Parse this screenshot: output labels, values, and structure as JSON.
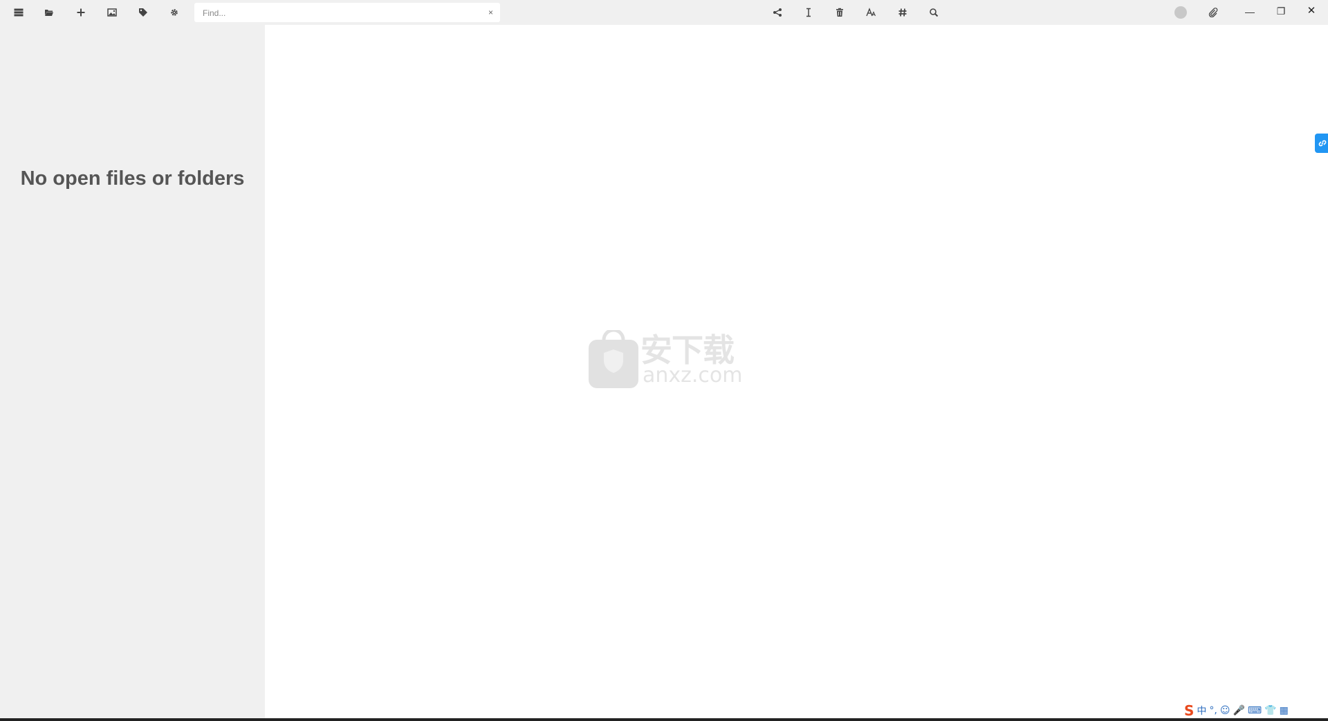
{
  "toolbar": {
    "left_icons": [
      "menu-icon",
      "folder-open-icon",
      "plus-icon",
      "image-icon",
      "tag-icon",
      "gear-icon"
    ],
    "find": {
      "placeholder": "Find...",
      "clear_glyph": "×"
    },
    "right_icons": [
      "share-icon",
      "text-cursor-icon",
      "trash-icon",
      "font-icon",
      "hashtag-icon",
      "search-icon"
    ],
    "avatar": "user-avatar",
    "attach_icon": "paperclip-icon",
    "window_controls": {
      "minimize": "—",
      "restore": "❐",
      "close": "✕"
    }
  },
  "sidebar": {
    "empty_message": "No open files or folders"
  },
  "editor": {
    "watermark_cn": "安下载",
    "watermark_url": "anxz.com"
  },
  "ime_bar": {
    "logo": "S",
    "items": [
      "中",
      "°,",
      "☺",
      "🎤",
      "⌨",
      "👕",
      "▦"
    ]
  },
  "colors": {
    "toolbar_bg": "#f0f0f0",
    "sidebar_bg": "#f0f0f0",
    "editor_bg": "#ffffff",
    "accent": "#2196f3"
  }
}
